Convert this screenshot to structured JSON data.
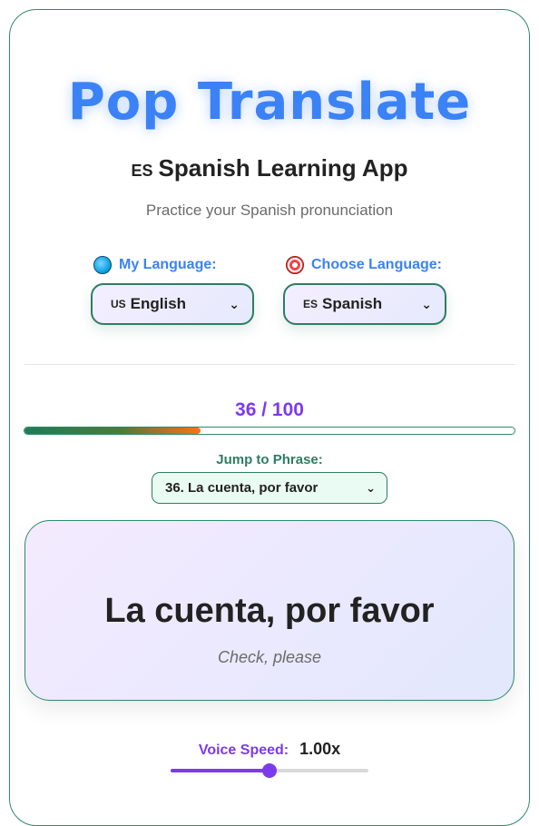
{
  "app": {
    "title": "Pop Translate",
    "subtitle_flag": "ES",
    "subtitle": "Spanish Learning App",
    "tagline": "Practice your Spanish pronunciation"
  },
  "languages": {
    "my_label": "My Language:",
    "my_icon": "globe-icon",
    "my_flag": "US",
    "my_value": "English",
    "choose_label": "Choose Language:",
    "choose_icon": "target-icon",
    "choose_flag": "ES",
    "choose_value": "Spanish"
  },
  "progress": {
    "text": "36 / 100",
    "current": 36,
    "total": 100
  },
  "jump": {
    "label": "Jump to Phrase:",
    "selected": "36. La cuenta, por favor"
  },
  "phrase": {
    "text": "La cuenta, por favor",
    "translation": "Check, please"
  },
  "voice": {
    "label": "Voice Speed:",
    "value_text": "1.00x",
    "value": 1.0,
    "slider_fraction": 0.5
  },
  "colors": {
    "accent_blue": "#3b82f6",
    "accent_purple": "#7c3aed",
    "accent_green": "#2e7d63"
  }
}
